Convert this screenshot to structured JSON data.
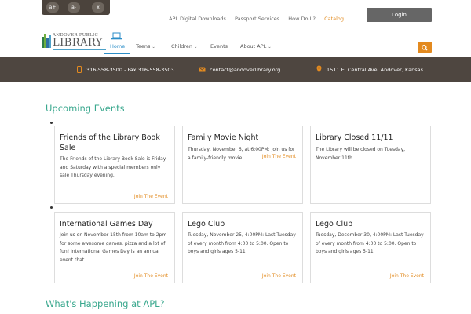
{
  "accessibility": {
    "increase": "a+",
    "decrease": "a-",
    "close": "x"
  },
  "top_links": [
    "APL Digital Downloads",
    "Passport Services",
    "How Do I ?",
    "Catalog"
  ],
  "login_label": "Login",
  "logo": {
    "line1": "ANDOVER PUBLIC",
    "line2": "LIBRARY"
  },
  "nav": {
    "home": "Home",
    "teens": "Teens",
    "children": "Children",
    "events": "Events",
    "about": "About APL"
  },
  "contact": {
    "phone": "316-558-3500 - Fax 316-558-3503",
    "email": "contact@andoverlibrary.org",
    "address": "1511 E. Central Ave, Andover, Kansas"
  },
  "upcoming_title": "Upcoming Events",
  "events": [
    {
      "title": "Friends of the Library Book Sale",
      "desc": "The Friends of the Library Book Sale is Friday and Saturday with a special members only sale Thursday evening.",
      "join": "Join The Event"
    },
    {
      "title": "Family Movie Night",
      "desc": "Thursday, November 6, at 6:00PM: Join us for a family-friendly movie.",
      "join": "Join The Event"
    },
    {
      "title": "Library Closed 11/11",
      "desc": "The Library will be closed on Tuesday, November 11th.",
      "join": ""
    },
    {
      "title": "International Games Day",
      "desc": "Join us on November 15th from 10am to 2pm for some awesome games, pizza and a lot of fun! International Games Day is an annual event that",
      "join": "Join The Event"
    },
    {
      "title": "Lego Club",
      "desc": "Tuesday, November 25, 4:00PM: Last Tuesday of every month from 4:00 to 5:00. Open to boys and girls ages 5-11.",
      "join": "Join The Event"
    },
    {
      "title": "Lego Club",
      "desc": "Tuesday, December 30, 4:00PM: Last Tuesday of every month from 4:00 to 5:00. Open to boys and girls ages 5-11.",
      "join": "Join The Event"
    }
  ],
  "happening_title": "What's Happening at APL?",
  "colors": {
    "accent_orange": "#e28a1d",
    "nav_blue": "#2b8ec8",
    "title_green": "#3aa88e",
    "band_brown": "#4e4640"
  },
  "icons": [
    "laptop-icon",
    "chevron-down-icon",
    "search-icon",
    "phone-icon",
    "email-icon",
    "map-pin-icon"
  ]
}
